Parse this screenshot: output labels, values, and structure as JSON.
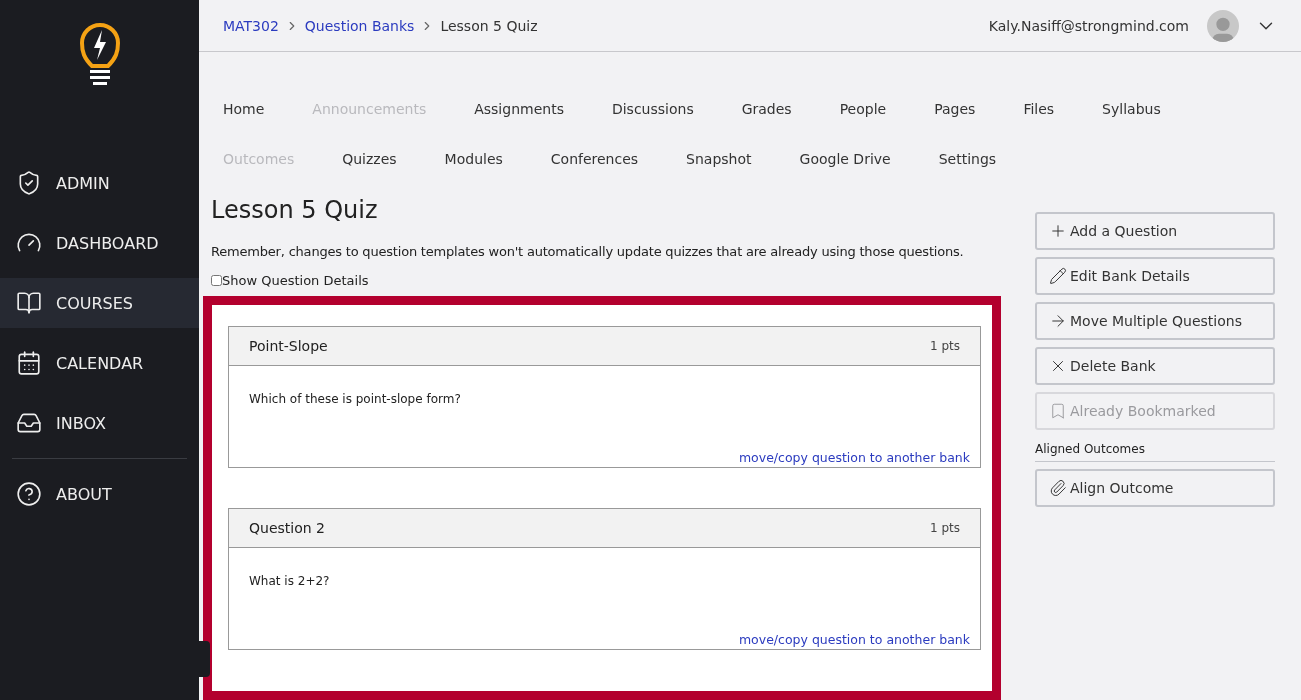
{
  "sidebar": {
    "items": [
      {
        "label": "ADMIN",
        "kind": "admin",
        "selected": false
      },
      {
        "label": "DASHBOARD",
        "kind": "dashboard",
        "selected": false
      },
      {
        "label": "COURSES",
        "kind": "courses",
        "selected": true
      },
      {
        "label": "CALENDAR",
        "kind": "calendar",
        "selected": false
      },
      {
        "label": "INBOX",
        "kind": "inbox",
        "selected": false
      }
    ],
    "footer_items": [
      {
        "label": "ABOUT",
        "kind": "about",
        "selected": false
      }
    ]
  },
  "breadcrumbs": [
    {
      "label": "MAT302",
      "selected": false
    },
    {
      "label": "Question Banks",
      "selected": false
    },
    {
      "label": "Lesson 5 Quiz",
      "selected": true
    }
  ],
  "user": {
    "email": "Kaly.Nasiff@strongmind.com"
  },
  "course_nav": [
    [
      {
        "label": "Home",
        "disabled": false
      },
      {
        "label": "Announcements",
        "disabled": true
      },
      {
        "label": "Assignments",
        "disabled": false
      },
      {
        "label": "Discussions",
        "disabled": false
      },
      {
        "label": "Grades",
        "disabled": false
      },
      {
        "label": "People",
        "disabled": false
      },
      {
        "label": "Pages",
        "disabled": false
      },
      {
        "label": "Files",
        "disabled": false
      },
      {
        "label": "Syllabus",
        "disabled": false
      }
    ],
    [
      {
        "label": "Outcomes",
        "disabled": true
      },
      {
        "label": "Quizzes",
        "disabled": false
      },
      {
        "label": "Modules",
        "disabled": false
      },
      {
        "label": "Conferences",
        "disabled": false
      },
      {
        "label": "Snapshot",
        "disabled": false
      },
      {
        "label": "Google Drive",
        "disabled": false
      },
      {
        "label": "Settings",
        "disabled": false
      }
    ]
  ],
  "page_title": "Lesson 5 Quiz",
  "notice": "Remember, changes to question templates won't automatically update quizzes that are already using those questions.",
  "show_details": {
    "label": "Show Question Details",
    "checked": false
  },
  "questions": [
    {
      "title": "Point-Slope",
      "points": "1 pts",
      "text": "Which of these is point-slope form?",
      "link": "move/copy question to another bank"
    },
    {
      "title": "Question 2",
      "points": "1 pts",
      "text": "What is 2+2?",
      "link": "move/copy question to another bank"
    }
  ],
  "actions": [
    {
      "label": "Add a Question",
      "kind": "plus",
      "disabled": false
    },
    {
      "label": "Edit Bank Details",
      "kind": "pencil",
      "disabled": false
    },
    {
      "label": "Move Multiple Questions",
      "kind": "arrow",
      "disabled": false
    },
    {
      "label": "Delete Bank",
      "kind": "x",
      "disabled": false
    },
    {
      "label": "Already Bookmarked",
      "kind": "bookmark",
      "disabled": true
    }
  ],
  "outcomes": {
    "heading": "Aligned Outcomes",
    "button": {
      "label": "Align Outcome",
      "kind": "paperclip"
    }
  }
}
